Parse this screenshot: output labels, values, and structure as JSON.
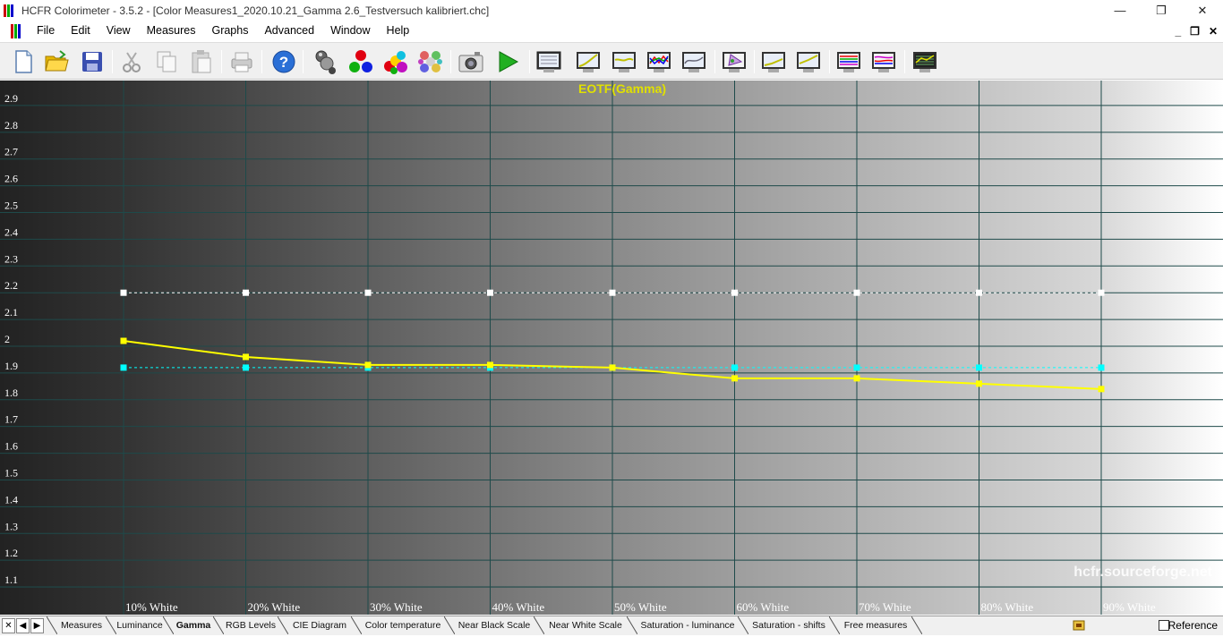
{
  "window": {
    "title": "HCFR Colorimeter - 3.5.2 - [Color Measures1_2020.10.21_Gamma 2.6_Testversuch kalibriert.chc]",
    "controls": {
      "minimize": "—",
      "restore": "❐",
      "close": "✕"
    }
  },
  "menubar": {
    "items": [
      "File",
      "Edit",
      "View",
      "Measures",
      "Graphs",
      "Advanced",
      "Window",
      "Help"
    ],
    "mdi": {
      "minimize": "_",
      "restore": "❐",
      "close": "✕"
    }
  },
  "toolbar": {
    "icons": [
      "new-document-icon",
      "open-folder-icon",
      "save-icon",
      "cut-icon",
      "copy-icon",
      "paste-icon",
      "print-icon",
      "help-icon",
      "sensor-icon",
      "rgb-balls-icon",
      "color-balls-icon",
      "multi-balls-icon",
      "camera-icon",
      "play-icon",
      "measures-view-icon",
      "luminance-graph-icon",
      "gamma-graph-icon",
      "rgb-levels-graph-icon",
      "color-temp-graph-icon",
      "cie-diagram-icon",
      "near-black-graph-icon",
      "near-white-graph-icon",
      "saturation-luminance-graph-icon",
      "saturation-shifts-graph-icon",
      "free-measures-graph-icon"
    ]
  },
  "chart_data": {
    "type": "line",
    "title": "EOTF(Gamma)",
    "watermark": "hcfr.sourceforge.net",
    "categories": [
      "10% White",
      "20% White",
      "30% White",
      "40% White",
      "50% White",
      "60% White",
      "70% White",
      "80% White",
      "90% White"
    ],
    "yticks": [
      1.1,
      1.2,
      1.3,
      1.4,
      1.5,
      1.6,
      1.7,
      1.8,
      1.9,
      2,
      2.1,
      2.2,
      2.3,
      2.4,
      2.5,
      2.6,
      2.7,
      2.8,
      2.9
    ],
    "ylim": [
      1.03,
      2.98
    ],
    "grid": true,
    "series": [
      {
        "key": "measured",
        "color": "#ffff00",
        "style": "solid",
        "values": [
          2.02,
          1.96,
          1.93,
          1.93,
          1.92,
          1.88,
          1.88,
          1.86,
          1.84
        ]
      },
      {
        "key": "reference",
        "color": "#00ffff",
        "style": "dashed",
        "values": [
          1.92,
          1.92,
          1.92,
          1.92,
          1.92,
          1.92,
          1.92,
          1.92,
          1.92
        ]
      },
      {
        "key": "target",
        "color": "#ffffff",
        "style": "dashed",
        "values": [
          2.2,
          2.2,
          2.2,
          2.2,
          2.2,
          2.2,
          2.2,
          2.2,
          2.2
        ]
      }
    ]
  },
  "tabs": {
    "nav": [
      "✕",
      "◀",
      "▶"
    ],
    "items": [
      "Measures",
      "Luminance",
      "Gamma",
      "RGB Levels",
      "CIE Diagram",
      "Color temperature",
      "Near Black Scale",
      "Near White Scale",
      "Saturation - luminance",
      "Saturation - shifts",
      "Free measures"
    ],
    "active": "Gamma",
    "reference_label": "Reference"
  },
  "colors": {
    "grid": "#1e4a4a",
    "title": "#e0e000",
    "tick_label": "#ffffff",
    "watermark": "#ffffff"
  }
}
